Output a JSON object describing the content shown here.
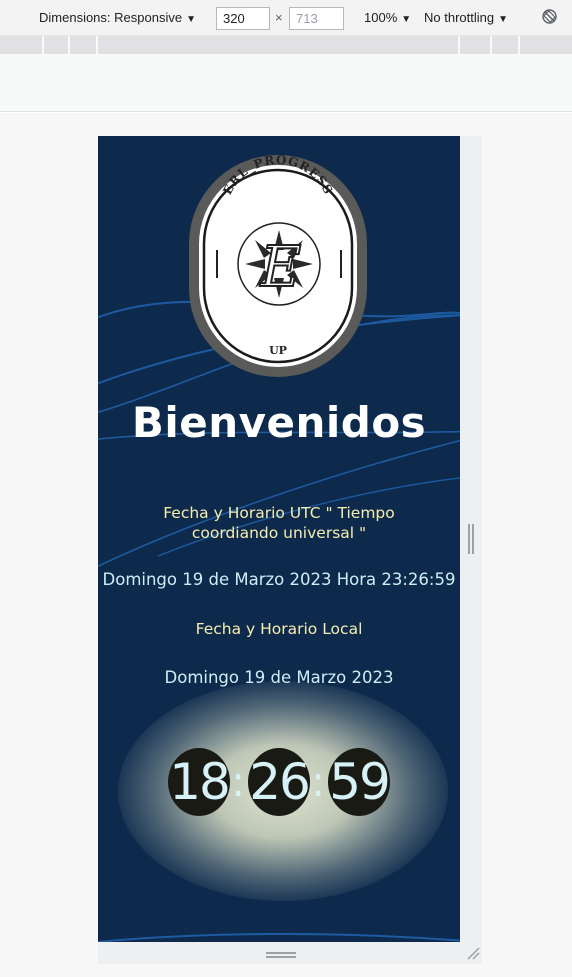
{
  "toolbar": {
    "dimensions_label": "Dimensions: Responsive",
    "width_value": "320",
    "height_placeholder": "713",
    "times": "×",
    "zoom": "100%",
    "throttling": "No throttling",
    "rotate_icon": "rotate-icon"
  },
  "page": {
    "logo_top_text": "ERL_PROGRESS",
    "logo_bottom_text": "UP",
    "logo_letter": "E",
    "title": "Bienvenidos",
    "utc_heading": "Fecha y Horario UTC \" Tiempo coordiando universal \"",
    "utc_heading_line1": "Fecha y Horario UTC \" Tiempo",
    "utc_heading_line2": "coordiando universal \"",
    "utc_datetime": "Domingo 19 de Marzo 2023 Hora 23:26:59",
    "local_heading": "Fecha y Horario Local",
    "local_date": "Domingo 19 de Marzo 2023",
    "clock": {
      "hours": "18",
      "minutes": "26",
      "seconds": "59",
      "separator": ":"
    }
  },
  "colors": {
    "background": "#0d2a4d",
    "heading_yellow": "#f6eeae",
    "text_cyan": "#cdeff4",
    "wave": "#1d5aa0"
  }
}
